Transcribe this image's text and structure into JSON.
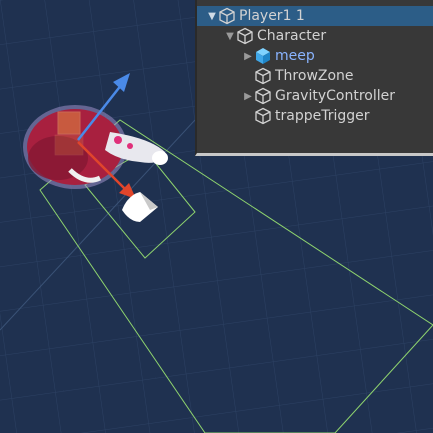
{
  "hierarchy": {
    "items": [
      {
        "label": "Player1 1",
        "indent": 0,
        "expand": "expanded",
        "selected": true,
        "icon": "gameobject-icon"
      },
      {
        "label": "Character",
        "indent": 1,
        "expand": "expanded",
        "selected": false,
        "icon": "gameobject-icon"
      },
      {
        "label": "meep",
        "indent": 2,
        "expand": "collapsed",
        "selected": false,
        "icon": "prefab-icon"
      },
      {
        "label": "ThrowZone",
        "indent": 2,
        "expand": "none",
        "selected": false,
        "icon": "gameobject-icon"
      },
      {
        "label": "GravityController",
        "indent": 2,
        "expand": "collapsed",
        "selected": false,
        "icon": "gameobject-icon"
      },
      {
        "label": "trappeTrigger",
        "indent": 2,
        "expand": "none",
        "selected": false,
        "icon": "gameobject-icon"
      }
    ]
  },
  "colors": {
    "scene_background": "#1f3150",
    "gizmo_wire": "#8ed36e",
    "axis_x": "#e0452b",
    "axis_y": "#4a8ae8",
    "character_body": "#a8203f",
    "selection_highlight": "#2c5d87"
  }
}
